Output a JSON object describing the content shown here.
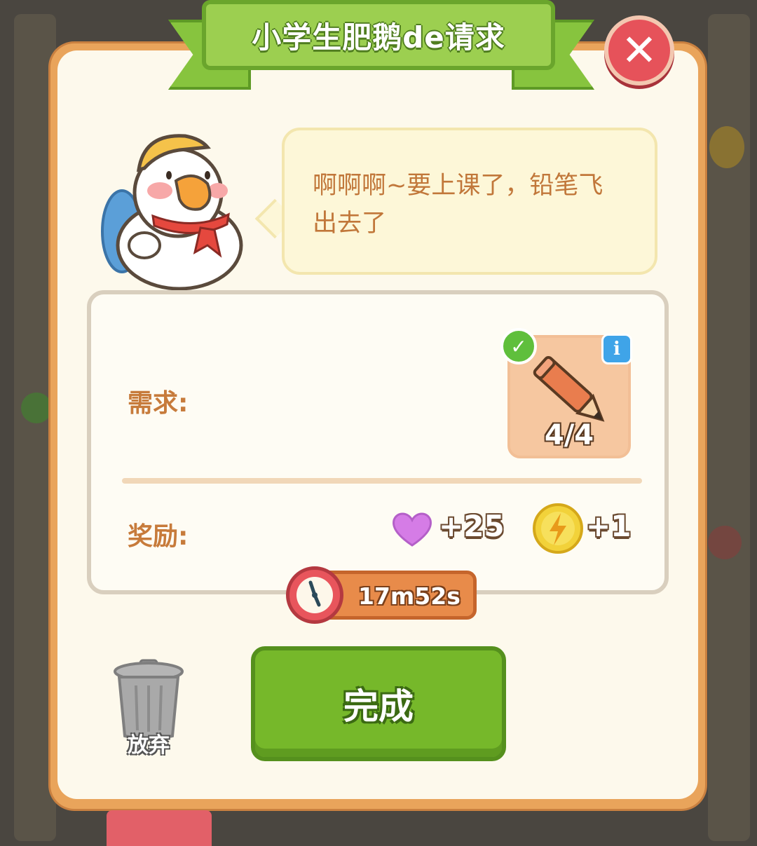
{
  "dialog": {
    "title": "小学生肥鹅de请求",
    "close_icon": "close-icon"
  },
  "speech": {
    "text": "啊啊啊~要上课了，铅笔飞出去了"
  },
  "request": {
    "label": "需求:",
    "item_icon": "pencil-icon",
    "item_count": "4/4",
    "completed": true
  },
  "reward": {
    "label": "奖励:",
    "items": [
      {
        "icon": "heart-icon",
        "value": "+25",
        "color": "#d57ce6"
      },
      {
        "icon": "lightning-coin-icon",
        "value": "+1",
        "color": "#f2d23a"
      }
    ]
  },
  "timer": {
    "value": "17m52s"
  },
  "actions": {
    "complete_label": "完成",
    "discard_label": "放弃"
  },
  "colors": {
    "panel_border": "#e9a45b",
    "panel_bg": "#fdf9ec",
    "ribbon_green": "#9ccf50",
    "button_green": "#76b82a",
    "close_red": "#e6525a",
    "text_orange": "#c77b3b"
  }
}
